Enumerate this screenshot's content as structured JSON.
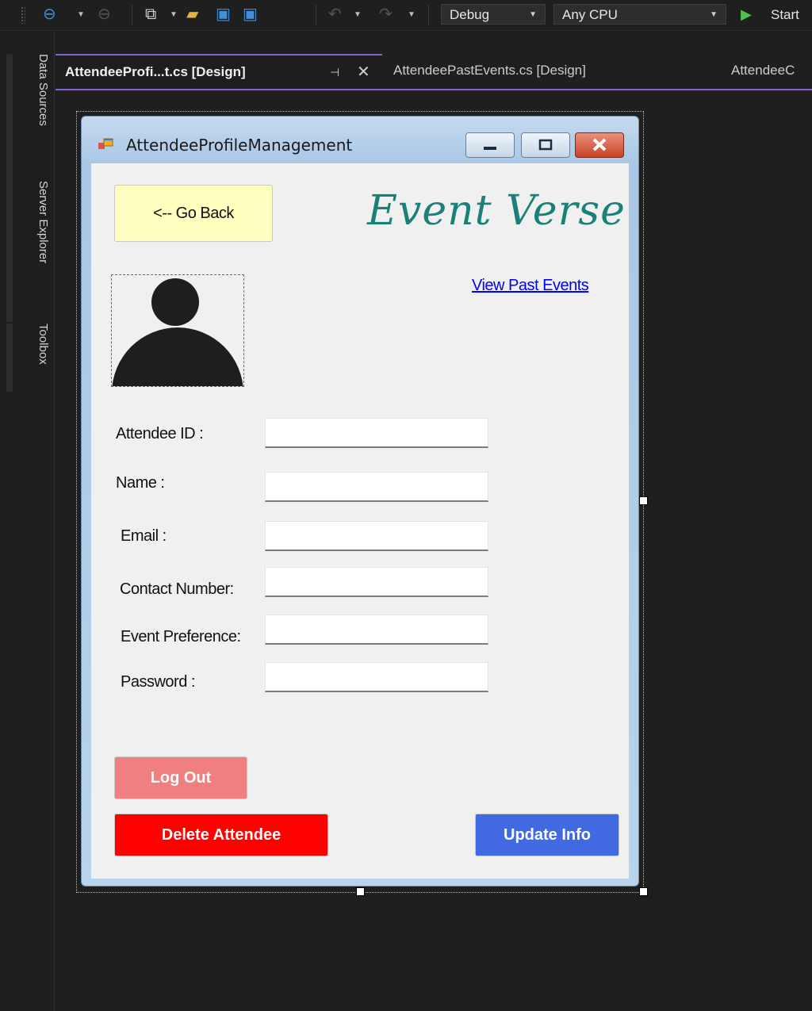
{
  "toolbar": {
    "icons": [
      "back-nav-icon",
      "forward-nav-icon",
      "new-item-icon",
      "open-folder-icon",
      "save-icon",
      "save-all-icon",
      "undo-icon",
      "redo-icon"
    ],
    "configuration": "Debug",
    "platform": "Any CPU",
    "start_label": "Start"
  },
  "side_panels": [
    "Data Sources",
    "Server Explorer",
    "Toolbox"
  ],
  "tabs": [
    {
      "label": "AttendeeProfi...t.cs [Design]",
      "active": true
    },
    {
      "label": "AttendeePastEvents.cs [Design]",
      "active": false
    },
    {
      "label": "AttendeeC",
      "active": false
    }
  ],
  "form": {
    "title": "AttendeeProfileManagement",
    "go_back": "<-- Go Back",
    "brand": "Event Verse",
    "past_events_link": "View Past Events",
    "fields": [
      {
        "label": "Attendee ID :",
        "value": ""
      },
      {
        "label": "Name :",
        "value": ""
      },
      {
        "label": "Email :",
        "value": ""
      },
      {
        "label": "Contact Number:",
        "value": ""
      },
      {
        "label": "Event Preference:",
        "value": ""
      },
      {
        "label": "Password :",
        "value": ""
      }
    ],
    "log_out": "Log Out",
    "delete": "Delete Attendee",
    "update": "Update Info"
  },
  "colors": {
    "accent": "#8560d6",
    "brand": "#1a8078",
    "go_back_bg": "#ffffc0",
    "log_out_bg": "#f08080",
    "delete_bg": "#ff0000",
    "update_bg": "#4169e1"
  }
}
